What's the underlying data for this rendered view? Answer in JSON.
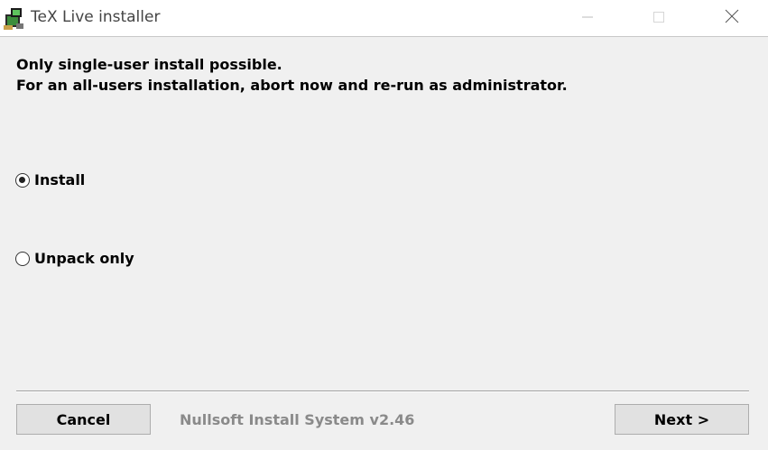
{
  "window": {
    "title": "TeX Live installer",
    "controls": {
      "minimize": "minimize-icon",
      "maximize": "maximize-icon",
      "close": "close-icon"
    }
  },
  "header": {
    "line1": "Only single-user install possible.",
    "line2": "For an all-users installation, abort now and re-run as administrator."
  },
  "options": {
    "install": {
      "label": "Install",
      "selected": true
    },
    "unpack": {
      "label": "Unpack only",
      "selected": false
    }
  },
  "footer": {
    "cancel_label": "Cancel",
    "branding": "Nullsoft Install System v2.46",
    "next_label": "Next >"
  }
}
